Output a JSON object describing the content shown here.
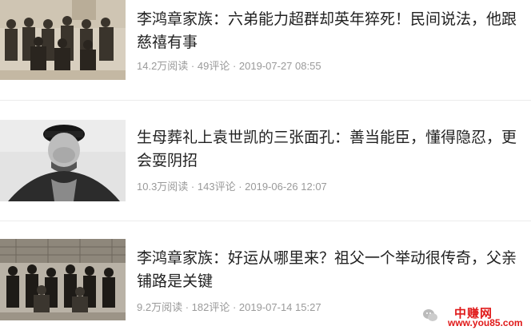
{
  "articles": [
    {
      "title": "李鸿章家族：六弟能力超群却英年猝死！民间说法，他跟慈禧有事",
      "reads": "14.2万阅读",
      "comments": "49评论",
      "date": "2019-07-27 08:55",
      "thumb_icon": "group-photo-thumbnail"
    },
    {
      "title": "生母葬礼上袁世凯的三张面孔：善当能臣，懂得隐忍，更会耍阴招",
      "reads": "10.3万阅读",
      "comments": "143评论",
      "date": "2019-06-26 12:07",
      "thumb_icon": "portrait-thumbnail"
    },
    {
      "title": "李鸿章家族：好运从哪里来？祖父一个举动很传奇，父亲铺路是关键",
      "reads": "9.2万阅读",
      "comments": "182评论",
      "date": "2019-07-14 15:27",
      "thumb_icon": "family-photo-thumbnail"
    }
  ],
  "meta_separator": " · ",
  "watermark": {
    "brand": "中赚网",
    "url": "www.you85.com"
  },
  "colors": {
    "title": "#222222",
    "meta": "#9a9a9a",
    "divider": "#ebebeb",
    "watermark": "#e01919"
  }
}
